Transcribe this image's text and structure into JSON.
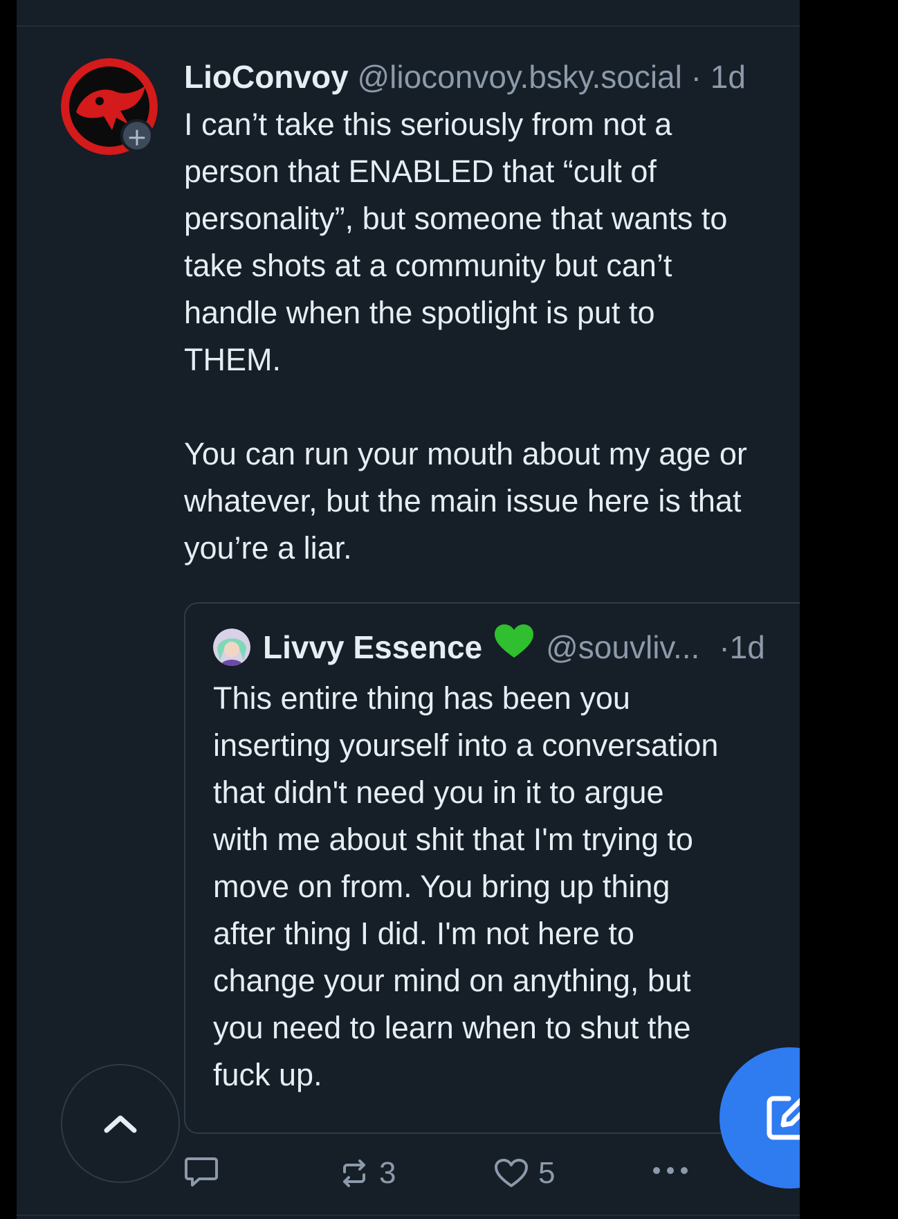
{
  "post": {
    "author": "LioConvoy",
    "handle": "@lioconvoy.bsky.social",
    "separator": " · ",
    "time": "1d",
    "body": "I can’t take this seriously from not a\nperson that ENABLED that “cult of\npersonality”, but someone that wants to\ntake shots at a community but can’t\nhandle when the spotlight is put to\nTHEM.\n\nYou can run your mouth about my age or\nwhatever, but the main issue here is that\nyou’re a liar.",
    "avatar_icon": "red-black-cat-logo-avatar",
    "follow_badge": "+"
  },
  "quote": {
    "author": "Livvy Essence",
    "emoji": "💚",
    "handle": "@souvliv...",
    "separator": "·",
    "time": "1d",
    "body": "This entire thing has been you\ninserting yourself into a conversation\nthat didn't need you in it to argue\nwith me about shit that I'm trying to\nmove on from. You bring up thing\nafter thing I did. I'm not here to\nchange your mind on anything, but\nyou need to learn when to shut the\nfuck up.",
    "avatar_icon": "green-haired-character-avatar"
  },
  "actions": {
    "reply_icon": "speech-bubble-icon",
    "repost_icon": "repost-arrows-icon",
    "repost_count": "3",
    "like_icon": "heart-outline-icon",
    "like_count": "5",
    "more_icon": "ellipsis-icon"
  },
  "floating": {
    "scroll_top_icon": "chevron-up-icon",
    "compose_icon": "pencil-square-icon"
  },
  "colors": {
    "background": "#161e27",
    "text": "#e6edf3",
    "muted": "#8c9aab",
    "border": "#2e3b49",
    "accent": "#2f7bf0"
  }
}
